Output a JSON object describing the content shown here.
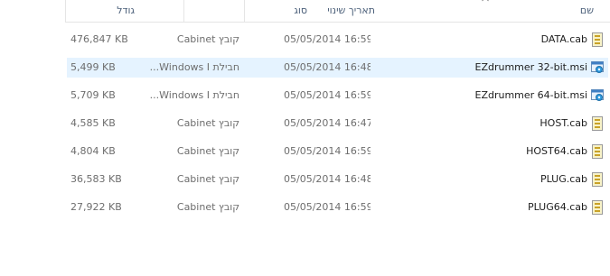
{
  "columns": {
    "size": "גודל",
    "type": "סוג",
    "date": "תאריך שינוי",
    "name": "שם"
  },
  "rows": [
    {
      "size": "476,847 KB",
      "type": "קובץ Cabinet",
      "date": "05/05/2014 16:59",
      "name": "DATA.cab",
      "icon": "cabinet-file-icon"
    },
    {
      "size": "5,499 KB",
      "type": "חבילת Windows I...",
      "date": "05/05/2014 16:48",
      "name": "EZdrummer 32-bit.msi",
      "icon": "msi-installer-icon"
    },
    {
      "size": "5,709 KB",
      "type": "חבילת Windows I...",
      "date": "05/05/2014 16:59",
      "name": "EZdrummer 64-bit.msi",
      "icon": "msi-installer-icon"
    },
    {
      "size": "4,585 KB",
      "type": "קובץ Cabinet",
      "date": "05/05/2014 16:47",
      "name": "HOST.cab",
      "icon": "cabinet-file-icon"
    },
    {
      "size": "4,804 KB",
      "type": "קובץ Cabinet",
      "date": "05/05/2014 16:59",
      "name": "HOST64.cab",
      "icon": "cabinet-file-icon"
    },
    {
      "size": "36,583 KB",
      "type": "קובץ Cabinet",
      "date": "05/05/2014 16:48",
      "name": "PLUG.cab",
      "icon": "cabinet-file-icon"
    },
    {
      "size": "27,922 KB",
      "type": "קובץ Cabinet",
      "date": "05/05/2014 16:59",
      "name": "PLUG64.cab",
      "icon": "cabinet-file-icon"
    }
  ],
  "colors": {
    "selected_row": "#e5f3ff",
    "header_text": "#4c607a",
    "secondary_text": "#6d6d6d"
  }
}
